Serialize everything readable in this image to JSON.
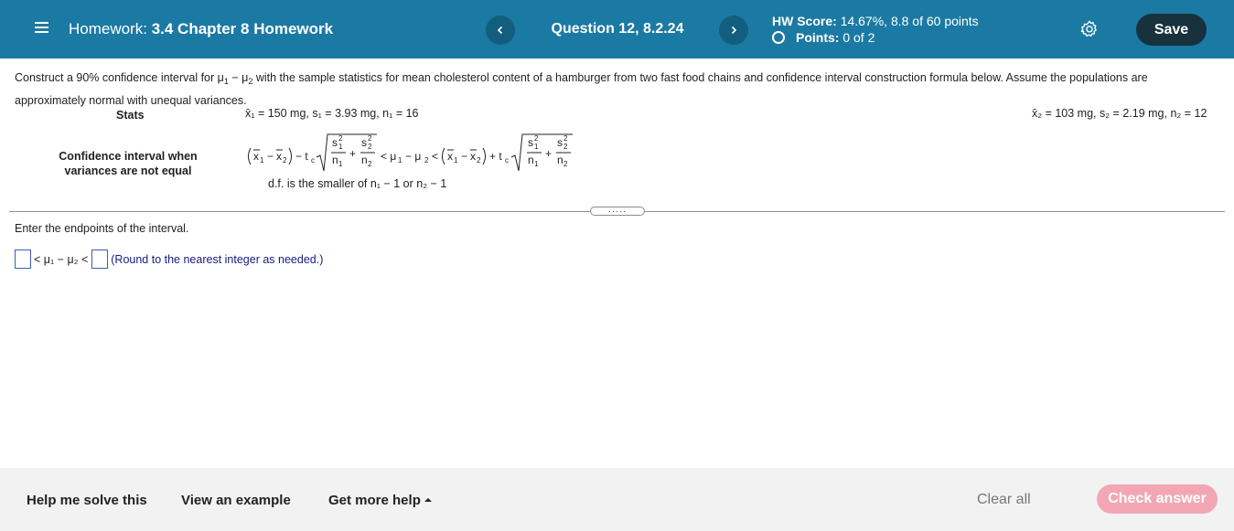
{
  "header": {
    "homework_prefix": "Homework:",
    "homework_title": "3.4 Chapter 8 Homework",
    "prev_label": "<",
    "next_label": ">",
    "question_label": "Question 12, 8.2.24",
    "hw_score_label": "HW Score:",
    "hw_score_value": "14.67%, 8.8 of 60 points",
    "points_label": "Points:",
    "points_value": "0 of 2",
    "save_label": "Save",
    "icons": [
      "menu-icon",
      "chevron-left-icon",
      "chevron-right-icon",
      "status-ring-icon",
      "gear-icon"
    ]
  },
  "question": {
    "prompt_line1": "Construct a 90% confidence interval for μ",
    "prompt_line2": " with the sample statistics for mean cholesterol content of a hamburger from two fast food chains and confidence interval construction formula below. Assume the populations are approximately normal with unequal variances.",
    "stats_label": "Stats",
    "stats_sample1": "x̄₁ = 150 mg, s₁ = 3.93 mg, n₁ = 16",
    "stats_sample2": "x̄₂ = 103 mg, s₂ = 2.19 mg, n₂ = 12",
    "ci_label_line1": "Confidence interval when",
    "ci_label_line2": "variances are not equal",
    "df_text": "d.f. is the smaller of n₁ − 1 or n₂ − 1",
    "expand_label": "·····",
    "enter_text": "Enter the endpoints of the interval.",
    "answer_middle": "< μ₁ − μ₂ <",
    "answer_hint": "(Round to the nearest integer as needed.)",
    "answer_lower_value": "",
    "answer_upper_value": ""
  },
  "footer": {
    "help_solve_label": "Help me solve this",
    "view_example_label": "View an example",
    "more_help_label": "Get more help",
    "clear_all_label": "Clear all",
    "check_answer_label": "Check answer"
  },
  "colors": {
    "topbar": "#1b7aa3",
    "nav_button": "#135e7e",
    "save_button": "#17313d",
    "check_button": "#f3a7b4",
    "input_border": "#3a5fb0",
    "hint_text": "#1a1a80"
  }
}
